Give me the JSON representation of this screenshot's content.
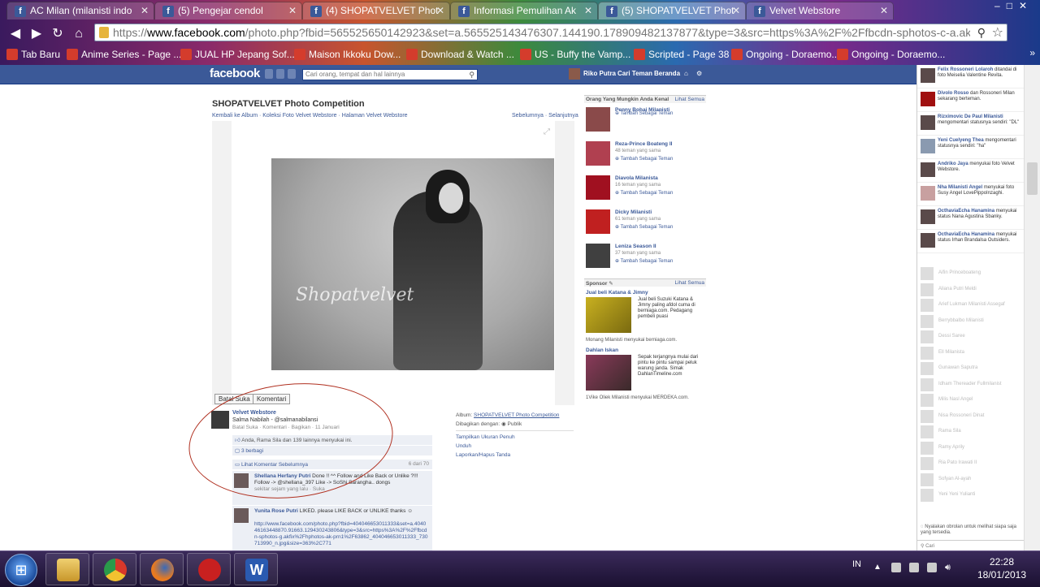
{
  "browser": {
    "tabs": [
      {
        "title": "AC Milan (milanisti indo"
      },
      {
        "title": "(5) Pengejar cendol"
      },
      {
        "title": "(4) SHOPATVELVET Phot"
      },
      {
        "title": "Informasi Pemulihan Ak"
      },
      {
        "title": "(5) SHOPATVELVET Phot",
        "active": true
      },
      {
        "title": "Velvet Webstore"
      }
    ],
    "url_prefix": "https://",
    "url_domain": "www.facebook.com",
    "url_rest": "/photo.php?fbid=565525650142923&set=a.565525143476307.144190.178909482137877&type=3&src=https%3A%2F%2Ffbcdn-sphotos-c-a.akan",
    "bookmarks": [
      "Tab Baru",
      "Anime Series - Page ...",
      "JUAL HP Jepang Sof...",
      "Maison Ikkoku Dow...",
      "Download & Watch ...",
      "US - Buffy the Vamp...",
      "Scripted - Page 38",
      "Ongoing - Doraemo...",
      "Ongoing - Doraemo..."
    ]
  },
  "fb": {
    "logo": "facebook",
    "search_placeholder": "Cari orang, tempat dan hal lainnya",
    "user": "Riko Putra",
    "nav": [
      "Cari Teman",
      "Beranda"
    ]
  },
  "photo": {
    "title": "SHOPATVELVET Photo Competition",
    "breadcrumb": "Kembali ke Album · Koleksi Foto Velvet Webstore · Halaman Velvet Webstore",
    "prevnext": "Sebelumnya · Selanjutnya",
    "watermark": "Shopatvelvet",
    "actions": [
      "Batal Suka",
      "Komentari"
    ]
  },
  "post": {
    "author": "Velvet Webstore",
    "caption": "Salma Nabilah - @salmanabilansi",
    "meta": "Batal Suka · Komentari · Bagikan · 11 Januari",
    "likes": "Anda, Rama Sila dan 139 lainnya menyukai ini.",
    "shares": "3 berbagi",
    "prev_comments": "Lihat Komentar Sebelumnya",
    "comment_count": "6 dari 70"
  },
  "comments": [
    {
      "author": "Shellana Herfany Putri",
      "text": "Done !! ^^ Follow and Like Back or Unlike ?!!! Follow -> @shellana_397 Like -> SoShi Sarangha.. dongs",
      "meta": "sekitar sejam yang lalu · Suka"
    },
    {
      "author": "Yunita Rose Putri",
      "text": "LIKED. please LIKE BACK or UNLIKE thanks",
      "link": "http://www.facebook.com/photo.php?fbid=404046653011333&set=a.404046163448870.91663.129430243806&type=3&src=https%3A%2F%2Ffbcdn-sphotos-g.akfix%2Fhphotos-ak-prn1%2F63862_404046653011333_730713990_n.jpg&size=363%2C771"
    }
  ],
  "album_info": {
    "album_label": "Album:",
    "album_name": "SHOPATVELVET Photo Competition",
    "shared_label": "Dibagikan dengan:",
    "shared_value": "Publik",
    "links": [
      "Tampilkan Ukuran Penuh",
      "Unduh",
      "Laporkan/Hapus Tanda"
    ]
  },
  "suggestions": {
    "heading": "Orang Yang Mungkin Anda Kenal",
    "see_all": "Lihat Semua",
    "add_label": "Tambah Sebagai Teman",
    "people": [
      {
        "name": "Penny Bohai Milanisti",
        "mutual": ""
      },
      {
        "name": "Reza-Prince Boateng II",
        "mutual": "48 teman yang sama"
      },
      {
        "name": "Diavola Milanista",
        "mutual": "16 teman yang sama"
      },
      {
        "name": "Dicky Milanisti",
        "mutual": "61 teman yang sama"
      },
      {
        "name": "Leniza Season II",
        "mutual": "37 teman yang sama"
      }
    ]
  },
  "sponsor": {
    "heading": "Sponsor",
    "see_all": "Lihat Semua",
    "ads": [
      {
        "title": "Jual beli Katana & Jimny",
        "text": "Jual beli Suzuki Katana & Jimny paling afdol cuma di berniaga.com. Pedagang pembeli puasi",
        "foot": "Monang Milanisti menyukai berniaga.com."
      },
      {
        "title": "Dahlan Iskan",
        "text": "Sepak terjangnya mulai dari pintu ke pintu sampai peluk warung janda. Simak DahlanTimeline.com",
        "foot": "1Vike Oliek Milanisti menyukai MERDEKA.com."
      }
    ]
  },
  "ticker": [
    {
      "name": "Felix Rossoneri Lolaroh",
      "text": "ditandai di foto Meiselia Valentine Revita."
    },
    {
      "name": "Divolo Rosso",
      "text": "dan Rossoneri Milan sekarang berteman."
    },
    {
      "name": "Rizximovic De Paul Milanisti",
      "text": "mengomentari statusnya sendiri: \"DL\""
    },
    {
      "name": "Yeni Cuelyeng Thea",
      "text": "mengomentari statusnya sendiri: \"ha\""
    },
    {
      "name": "Andriko Jaya",
      "text": "menyukai foto Velvet Webstore."
    },
    {
      "name": "Nha Milanisti Angel",
      "text": "menyukai foto Susy Angel LovePippoInzaghi."
    },
    {
      "name": "OcthaviaEcha Hanamina",
      "text": "menyukai status Nana Agustina Sbanky."
    },
    {
      "name": "OcthaviaEcha Hanamina",
      "text": "menyukai status Irhan Brandalsa Outsiders."
    }
  ],
  "chat_friends": [
    "Aifin Princeboateng",
    "Aliana Putri Meldi",
    "Arief Lukman Milanisti Assegaf",
    "Berrybbalbo Milanisti",
    "Dessi Saree",
    "Ell Milanista",
    "Gunawan Saputra",
    "Idham Thereader Fullmilanist",
    "Milis Nasl Angel",
    "Nisa Rossoneri Dinat",
    "Rama Sila",
    "Ramy Aprily",
    "Ria Pato Irawati II",
    "Sofyan Al-ayah",
    "Yeni Yeni Yulianti"
  ],
  "chat_hint": "Nyalakan obrolan untuk melihat siapa saja yang tersedia.",
  "chat_search": "Cari",
  "taskbar": {
    "lang": "IN",
    "time": "22:28",
    "date": "18/01/2013"
  },
  "colors": {
    "fb_blue": "#3b5998",
    "annotation_red": "#b03020"
  }
}
